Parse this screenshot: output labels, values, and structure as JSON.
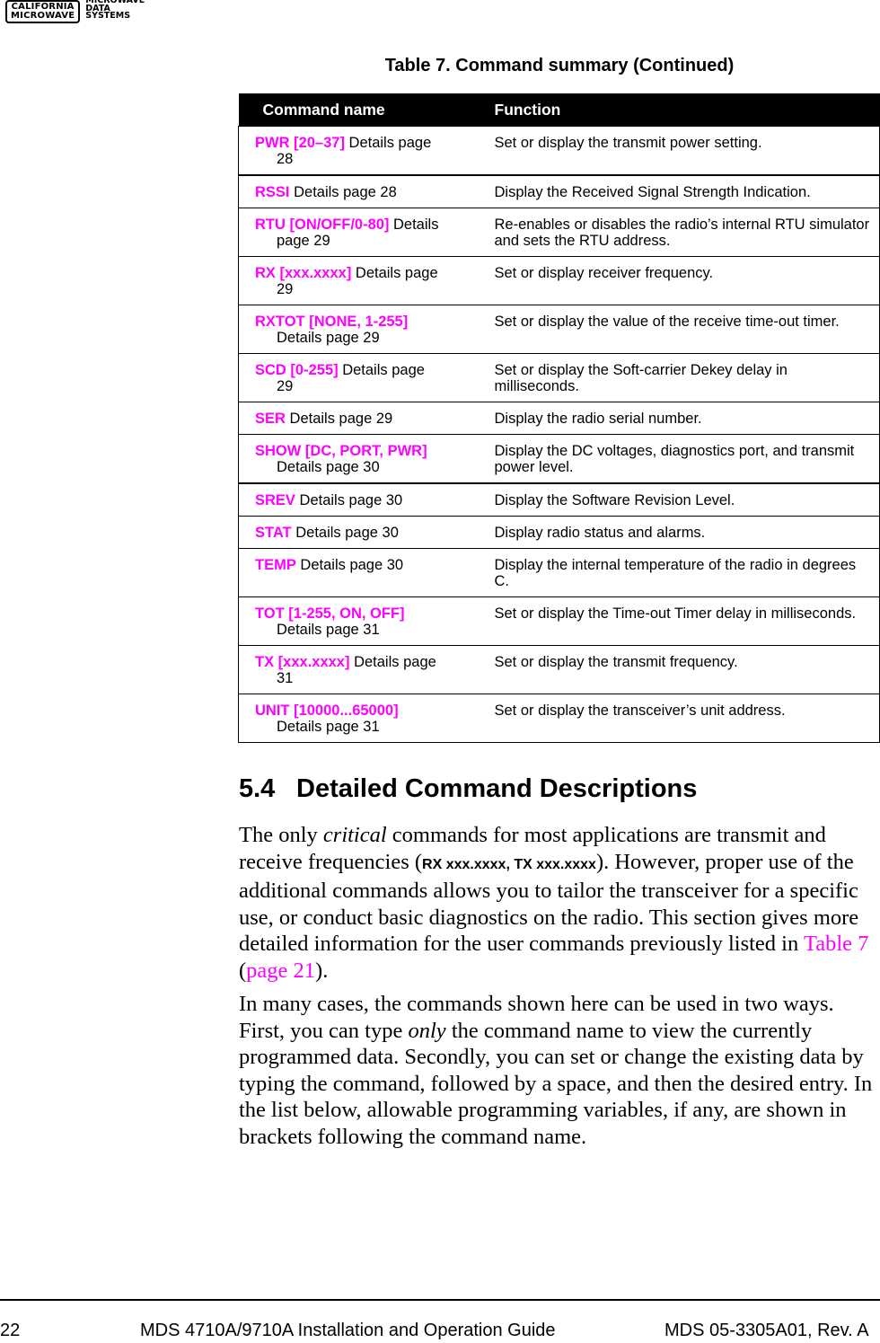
{
  "header": {
    "logo_box_line1": "CALIFORNIA",
    "logo_box_line2": "MICROWAVE",
    "logo_text_line1": "MICROWAVE",
    "logo_text_line2": "DATA",
    "logo_text_line3": "SYSTEMS"
  },
  "table": {
    "caption": "Table 7. Command summary (Continued)",
    "columns": [
      "Command name",
      "Function"
    ],
    "rows": [
      {
        "command": "PWR [20–37]",
        "details": " Details page",
        "details2": "28",
        "function": "Set or display the transmit power setting."
      },
      {
        "command": "RSSI",
        "details": " Details page 28",
        "details2": "",
        "function": "Display the Received Signal Strength Indication."
      },
      {
        "command": "RTU [ON/OFF/0-80]",
        "details": " Details",
        "details2": "page 29",
        "function": "Re-enables or disables the radio’s internal RTU simulator and sets the RTU address."
      },
      {
        "command": "RX [xxx.xxxx]",
        "details": " Details page",
        "details2": "29",
        "function": "Set or display receiver frequency."
      },
      {
        "command": "RXTOT [NONE, 1-255]",
        "details": "",
        "details2": "Details page 29",
        "function": "Set or display the value of the receive time-out timer."
      },
      {
        "command": "SCD [0-255]",
        "details": " Details page",
        "details2": "29",
        "function": "Set or display the Soft-carrier Dekey delay in milliseconds."
      },
      {
        "command": "SER",
        "details": " Details page 29",
        "details2": "",
        "function": "Display the radio serial number."
      },
      {
        "command": "SHOW [DC, PORT, PWR]",
        "details": "",
        "details2": "Details page 30",
        "function": "Display the DC voltages, diagnostics port, and transmit power level."
      },
      {
        "command": "SREV",
        "details": " Details page 30",
        "details2": "",
        "function": "Display the Software Revision Level."
      },
      {
        "command": "STAT",
        "details": " Details page 30",
        "details2": "",
        "function": "Display radio status and alarms."
      },
      {
        "command": "TEMP",
        "details": " Details page 30",
        "details2": "",
        "function": "Display the internal temperature of the radio in degrees C."
      },
      {
        "command": "TOT [1-255, ON, OFF]",
        "details": "",
        "details2": "Details page 31",
        "function": "Set or display the Time-out Timer delay in milliseconds."
      },
      {
        "command": "TX [xxx.xxxx]",
        "details": " Details page",
        "details2": "31",
        "function": "Set or display the transmit frequency."
      },
      {
        "command": "UNIT [10000...65000]",
        "details": "",
        "details2": "Details page 31",
        "function": "Set or display the transceiver’s unit address."
      }
    ]
  },
  "section": {
    "number": "5.4",
    "title": "Detailed Command Descriptions",
    "para1": {
      "t1": "The only ",
      "em1": "critical",
      "t2": " commands for most applications are transmit and receive frequencies (",
      "cmd": "RX xxx.xxxx, TX xxx.xxxx",
      "t3": "). However, proper use of the additional commands allows you to tailor the transceiver for a specific use, or conduct basic diagnostics on the radio. This section gives more detailed information for the user commands previously listed in ",
      "link1": "Table 7",
      "t4": " (",
      "link2": "page 21",
      "t5": ")."
    },
    "para2": {
      "t1": "In many cases, the commands shown here can be used in two ways. First, you can type ",
      "em1": "only",
      "t2": " the command name to view the currently programmed data. Secondly, you can set or change the existing data by typing the command, followed by a space, and then the desired entry. In the list below, allowable programming variables, if any, are shown in brackets following the command name."
    }
  },
  "footer": {
    "page_number": "22",
    "guide_title": "MDS 4710A/9710A Installation and Operation Guide",
    "doc_number": "MDS 05-3305A01, Rev. A"
  },
  "colors": {
    "accent": "#ff00ff",
    "header_bg": "#000000"
  }
}
